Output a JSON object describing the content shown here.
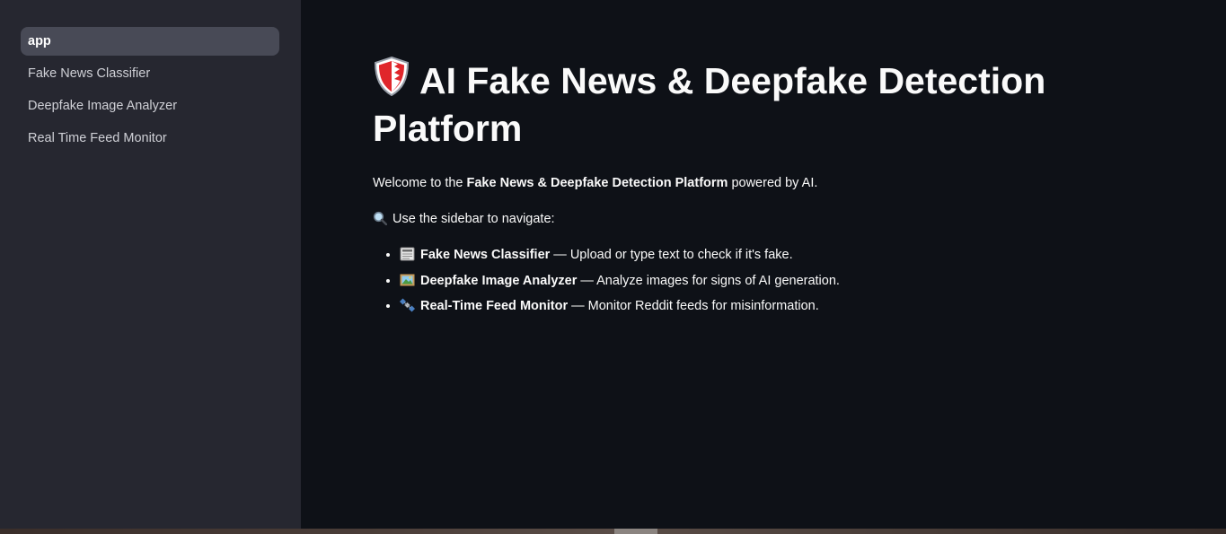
{
  "sidebar": {
    "items": [
      {
        "label": "app",
        "active": true
      },
      {
        "label": "Fake News Classifier",
        "active": false
      },
      {
        "label": "Deepfake Image Analyzer",
        "active": false
      },
      {
        "label": "Real Time Feed Monitor",
        "active": false
      }
    ]
  },
  "main": {
    "title_icon": "shield-icon",
    "title": "AI Fake News & Deepfake Detection Platform",
    "welcome": {
      "prefix": "Welcome to the ",
      "bold": "Fake News & Deepfake Detection Platform",
      "suffix": " powered by AI."
    },
    "nav_hint_icon": "magnifier-icon",
    "nav_hint": "Use the sidebar to navigate:",
    "features": [
      {
        "icon": "newspaper-icon",
        "name": "Fake News Classifier",
        "desc": " — Upload or type text to check if it's fake."
      },
      {
        "icon": "framed-picture-icon",
        "name": "Deepfake Image Analyzer",
        "desc": " — Analyze images for signs of AI generation."
      },
      {
        "icon": "satellite-icon",
        "name": "Real-Time Feed Monitor",
        "desc": " — Monitor Reddit feeds for misinformation."
      }
    ]
  },
  "colors": {
    "main_bg": "#0e1117",
    "sidebar_bg": "#262730",
    "active_item_bg": "#484a56",
    "text": "#fafafa",
    "shield_red": "#e0262b"
  }
}
